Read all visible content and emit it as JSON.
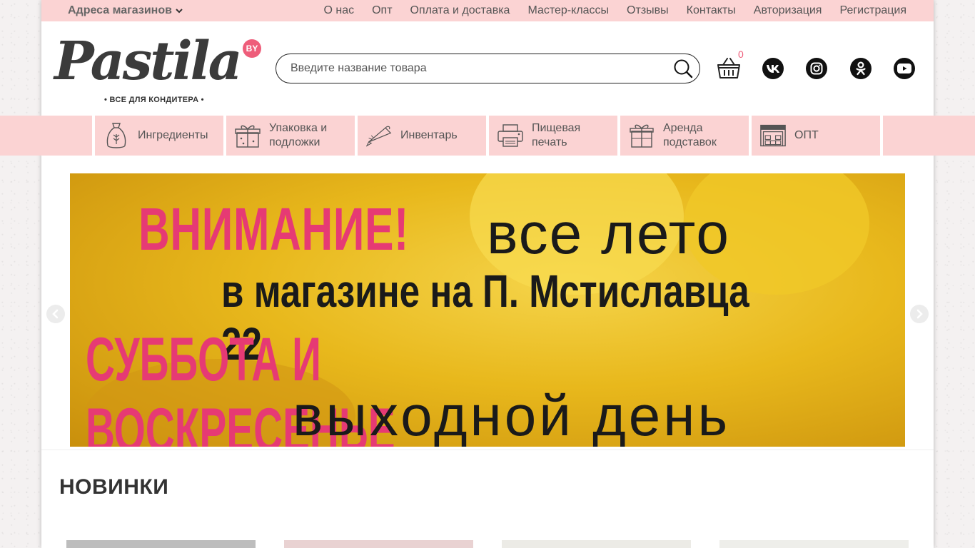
{
  "topbar": {
    "store_addresses": "Адреса магазинов",
    "links": [
      "О нас",
      "Опт",
      "Оплата и доставка",
      "Мастер-классы",
      "Отзывы",
      "Контакты",
      "Авторизация",
      "Регистрация"
    ]
  },
  "logo": {
    "word": "Pastila",
    "badge": "BY",
    "tagline": "• ВСЕ ДЛЯ КОНДИТЕРА •"
  },
  "search": {
    "placeholder": "Введите название товара"
  },
  "cart": {
    "count": "0"
  },
  "social": [
    "vk-icon",
    "instagram-icon",
    "odnoklassniki-icon",
    "youtube-icon"
  ],
  "categories": [
    {
      "label": "Ингредиенты",
      "icon": "ingredients-bag-icon"
    },
    {
      "label": "Упаковка и\nподложки",
      "icon": "gift-box-icon"
    },
    {
      "label": "Инвентарь",
      "icon": "piping-bag-icon"
    },
    {
      "label": "Пищевая\nпечать",
      "icon": "printer-icon"
    },
    {
      "label": "Аренда\nподставок",
      "icon": "gift-stand-icon"
    },
    {
      "label": "ОПТ",
      "icon": "warehouse-icon"
    }
  ],
  "banner": {
    "line1": "ВНИМАНИЕ!",
    "line2": "все лето",
    "line3": "в магазине на П. Мстиславца 22",
    "line4": "СУББОТА И ВОСКРЕСЕНЬЕ",
    "line5": "выходной день"
  },
  "sections": {
    "new_title": "НОВИНКИ"
  },
  "colors": {
    "pink_bar": "#fbd3d3",
    "accent": "#e63a74",
    "banner_yellow": "#f5d44a"
  }
}
